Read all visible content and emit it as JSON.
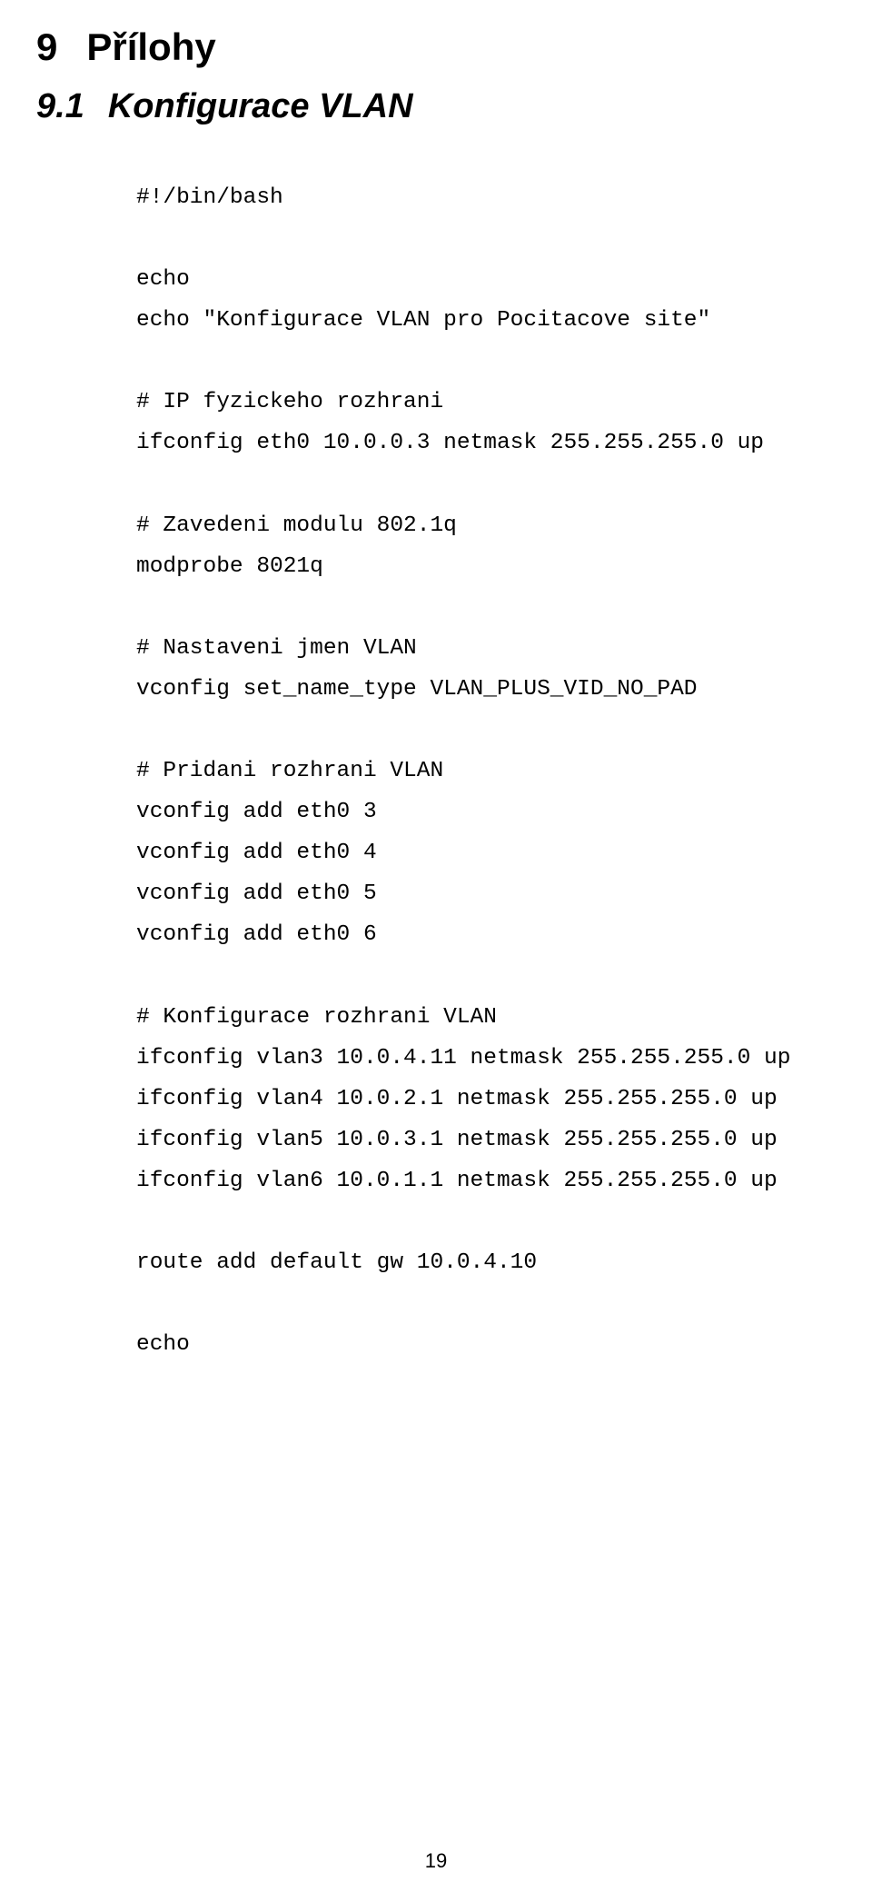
{
  "chapter": {
    "number": "9",
    "title": "Přílohy"
  },
  "section": {
    "number": "9.1",
    "title": "Konfigurace VLAN"
  },
  "code": {
    "l0": "#!/bin/bash",
    "l1": "",
    "l2": "echo",
    "l3": "echo \"Konfigurace VLAN pro Pocitacove site\"",
    "l4": "",
    "l5": "# IP fyzickeho rozhrani",
    "l6": "ifconfig eth0 10.0.0.3 netmask 255.255.255.0 up",
    "l7": "",
    "l8": "# Zavedeni modulu 802.1q",
    "l9": "modprobe 8021q",
    "l10": "",
    "l11": "# Nastaveni jmen VLAN",
    "l12": "vconfig set_name_type VLAN_PLUS_VID_NO_PAD",
    "l13": "",
    "l14": "# Pridani rozhrani VLAN",
    "l15": "vconfig add eth0 3",
    "l16": "vconfig add eth0 4",
    "l17": "vconfig add eth0 5",
    "l18": "vconfig add eth0 6",
    "l19": "",
    "l20": "# Konfigurace rozhrani VLAN",
    "l21": "ifconfig vlan3 10.0.4.11 netmask 255.255.255.0 up",
    "l22": "ifconfig vlan4 10.0.2.1 netmask 255.255.255.0 up",
    "l23": "ifconfig vlan5 10.0.3.1 netmask 255.255.255.0 up",
    "l24": "ifconfig vlan6 10.0.1.1 netmask 255.255.255.0 up",
    "l25": "",
    "l26": "route add default gw 10.0.4.10",
    "l27": "",
    "l28": "echo"
  },
  "pageNumber": "19"
}
